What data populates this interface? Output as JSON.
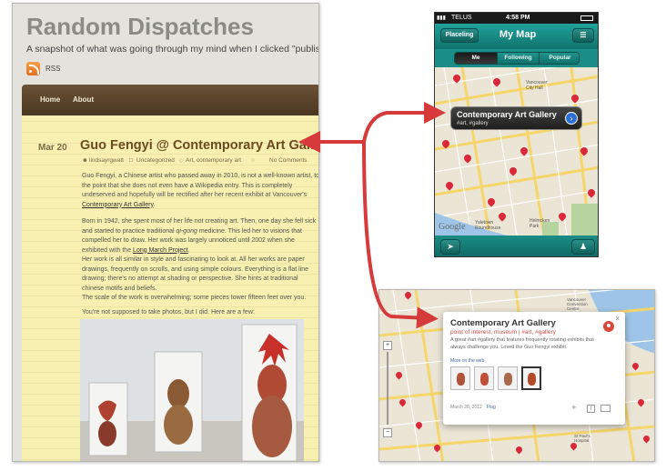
{
  "blog": {
    "title": "Random Dispatches",
    "tagline": "A snapshot of what was going through my mind when I clicked \"publish\"",
    "rss_label": "RSS",
    "nav": {
      "home": "Home",
      "about": "About"
    },
    "post": {
      "date": "Mar 20",
      "title": "Guo Fengyi @ Contemporary Art Gallery",
      "author": "lindsayrgwatt",
      "category": "Uncategorized",
      "tags": "Art, contemporary art",
      "comments": "No Comments",
      "p1": "Guo Fengyi, a Chinese artist who passed away in 2010, is not a well-known artist, to the point that she does not even have a Wikipedia entry. This is completely undeserved and hopefully will be rectified after her recent exhibit at Vancouver's",
      "p1_link": "Contemporary Art Gallery",
      "p1_end": ".",
      "p2_a": "Born in 1942, she spent most of her life not creating art. Then, one day she fell sick and started to practice traditional",
      "p2_italic": "qi-gong",
      "p2_b": "medicine. This led her to visions that compelled her to draw. Her work was largely unnoticed until 2002 when she exhibited with the",
      "p2_link": "Long March Project",
      "p2_end": ".",
      "p3": "Her work is all similar in style and fascinating to look at. All her works are paper drawings, frequently on scrolls, and using simple colours. Everything is a flat line drawing; there's no attempt at shading or perspective. She hints at traditional chinese motifs and beliefs.",
      "p4": "The scale of the work is overwhelming; some pieces tower fifteen feet over you.",
      "p5": "You're not supposed to take photos, but I did. Here are a few:"
    }
  },
  "phone": {
    "carrier": "TELUS",
    "time": "4:58 PM",
    "back_button": "Placeling",
    "title": "My Map",
    "tabs": [
      "Me",
      "Following",
      "Popular"
    ],
    "selected_tab": "Me",
    "callout_title": "Contemporary Art Gallery",
    "callout_tags": "#art, #gallery",
    "map_labels": {
      "vancouver_city": "Vancouver City Hall",
      "roundhouse": "Yaletown Roundhouse",
      "helmcken": "Helmcken Park",
      "google": "Google"
    }
  },
  "webmap": {
    "popup_title": "Contemporary Art Gallery",
    "popup_sub": "point of interest, museum | #art, #gallery",
    "popup_desc": "A great #art #gallery that features frequently rotating exhibits that always challenge you. Loved the Guo Fengyi exhibit.",
    "popup_more": "More on the web",
    "popup_date": "March 20, 2012",
    "popup_flag": "Flag",
    "popup_close": "×",
    "map_labels": {
      "vancouver": "Vancouver Convention Centre",
      "st_pauls": "St Paul's Hospital"
    }
  },
  "colors": {
    "pin": "#d9283a",
    "arrow": "#d63a3a",
    "teal": "#15867f",
    "post_title": "#6b4a22"
  }
}
